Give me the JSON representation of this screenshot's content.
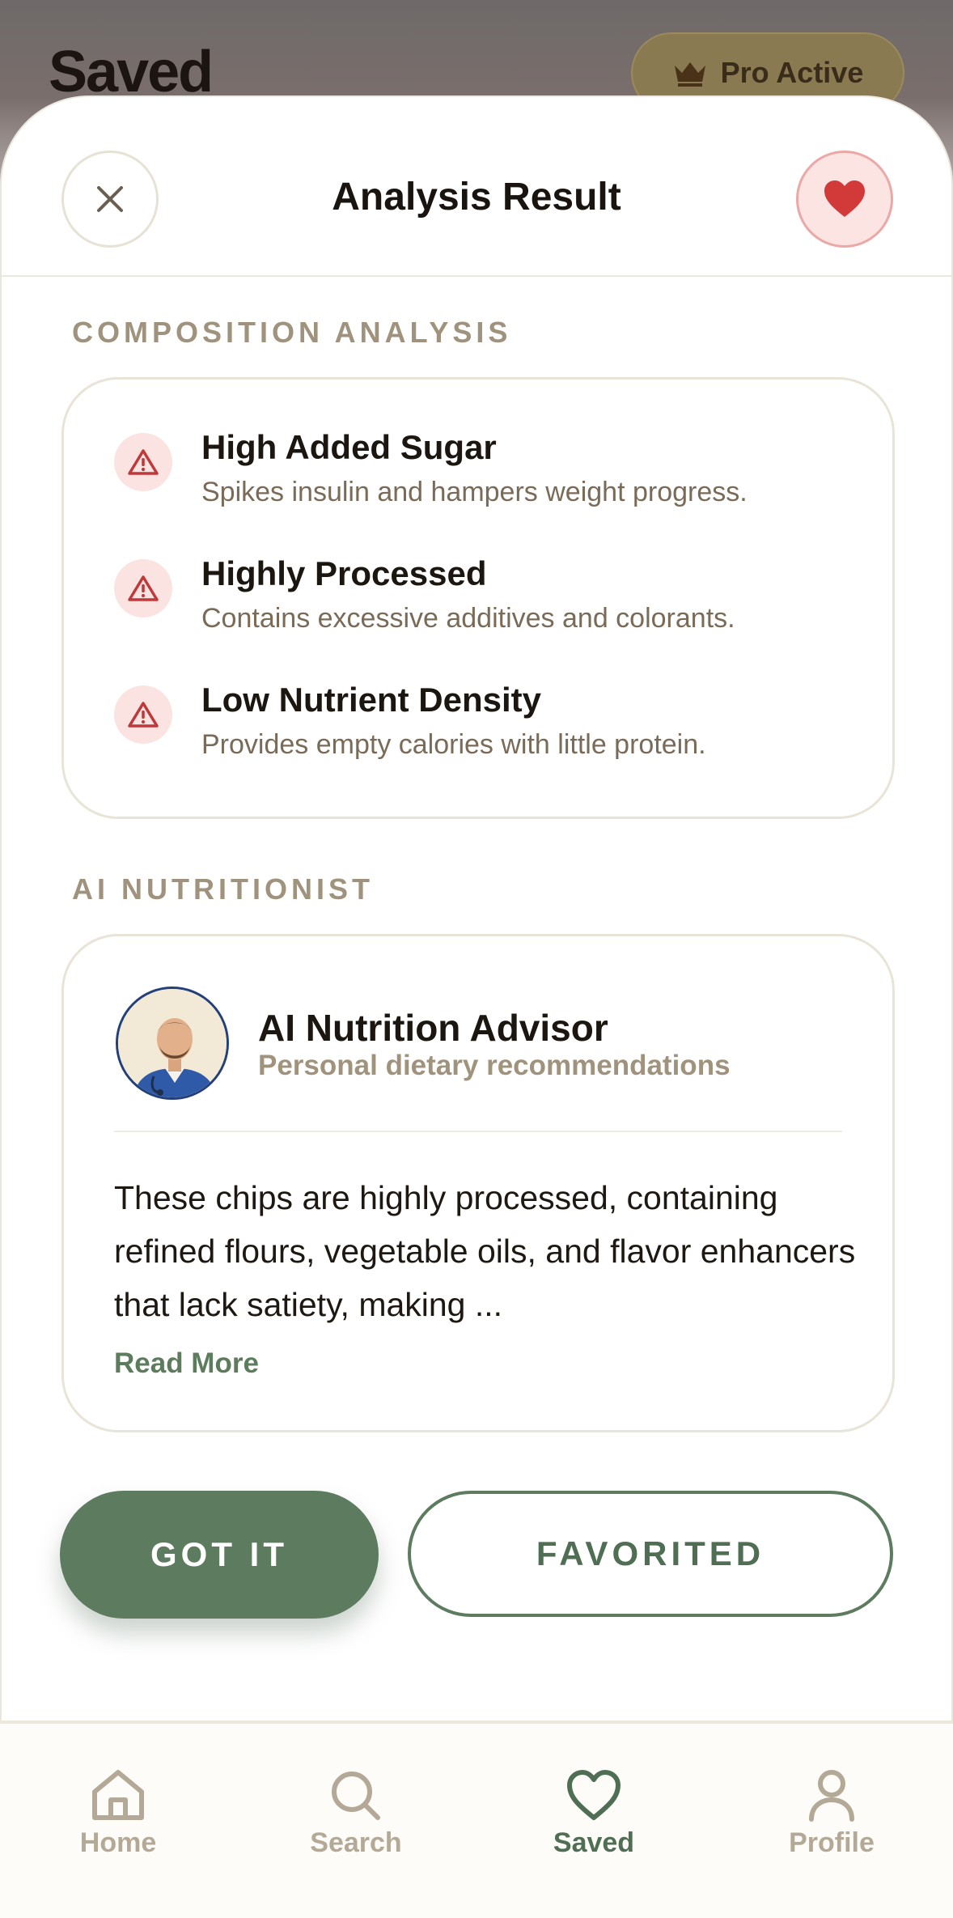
{
  "background": {
    "title": "Saved",
    "pro_badge": "Pro Active"
  },
  "sheet": {
    "title": "Analysis Result",
    "composition": {
      "label": "COMPOSITION ANALYSIS",
      "items": [
        {
          "title": "High Added Sugar",
          "desc": "Spikes insulin and hampers weight progress."
        },
        {
          "title": "Highly Processed",
          "desc": "Contains excessive additives and colorants."
        },
        {
          "title": "Low Nutrient Density",
          "desc": "Provides empty calories with little protein."
        }
      ]
    },
    "nutritionist": {
      "label": "AI NUTRITIONIST",
      "name": "AI Nutrition Advisor",
      "subtitle": "Personal dietary recommendations",
      "text": "These chips are highly processed, containing refined flours, vegetable oils, and flavor enhancers that lack satiety, making ...",
      "read_more": "Read More"
    },
    "buttons": {
      "got_it": "GOT IT",
      "favorited": "FAVORITED"
    }
  },
  "nav": {
    "items": [
      {
        "label": "Home",
        "icon": "home-icon"
      },
      {
        "label": "Search",
        "icon": "search-icon"
      },
      {
        "label": "Saved",
        "icon": "heart-icon",
        "active": true
      },
      {
        "label": "Profile",
        "icon": "user-icon"
      }
    ]
  },
  "colors": {
    "accent": "#5c7b5f",
    "warning": "#c0393a",
    "muted": "#a0937d"
  }
}
